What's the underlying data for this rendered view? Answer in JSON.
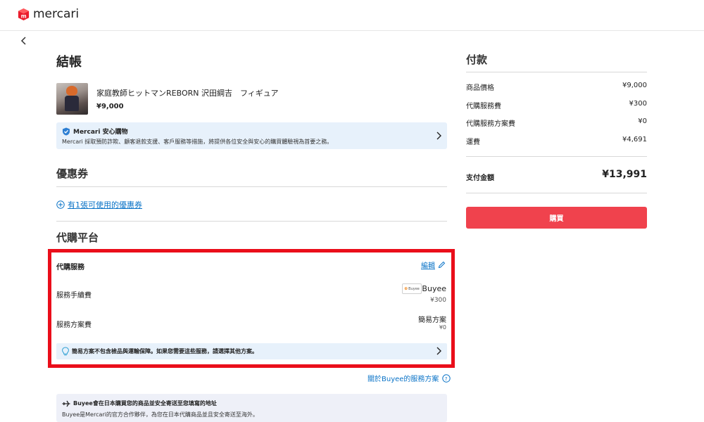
{
  "header": {
    "logo_text": "mercari",
    "brand_color": "#ea1c2c"
  },
  "nav": {
    "back_icon": "chevron-left-icon"
  },
  "checkout": {
    "title": "結帳",
    "product": {
      "name": "家庭教師ヒットマンREBORN 沢田綱吉　フィギュア",
      "price": "¥9,000"
    },
    "safe_box": {
      "title": "Mercari 安心購物",
      "desc": "Mercari 採取預防詐欺、顧客退款支援、客戶服務等措施，將提供各位安全與安心的購買體驗視為首要之務。"
    },
    "coupon": {
      "title": "優惠券",
      "link": "有1張可使用的優惠券"
    },
    "proxy": {
      "title": "代購平台",
      "service_label": "代購服務",
      "edit_label": "編輯",
      "fee_label": "服務手續費",
      "provider_name": "Buyee",
      "provider_badge": "Buyee",
      "fee_value": "¥300",
      "plan_label": "服務方案費",
      "plan_name": "簡易方案",
      "plan_value": "¥0",
      "tip": "簡易方案不包含檢品與運輸保障。如果您需要這些服務，請選擇其他方案。",
      "about_link": "關於Buyee的服務方案"
    },
    "shipping": {
      "title": "Buyee會在日本購買您的商品並安全寄送至您填寫的地址",
      "desc": "Buyee是Mercari的官方合作夥伴，為您在日本代購商品並且安全寄送至海外。"
    }
  },
  "payment": {
    "title": "付款",
    "rows": [
      {
        "label": "商品價格",
        "value": "¥9,000"
      },
      {
        "label": "代購服務費",
        "value": "¥300"
      },
      {
        "label": "代購服務方案費",
        "value": "¥0"
      },
      {
        "label": "運費",
        "value": "¥4,691"
      }
    ],
    "total_label": "支付金額",
    "total_value": "¥13,991",
    "buy_label": "購買",
    "buy_color": "#f0424d"
  },
  "highlight_color": "#ea0e1a"
}
